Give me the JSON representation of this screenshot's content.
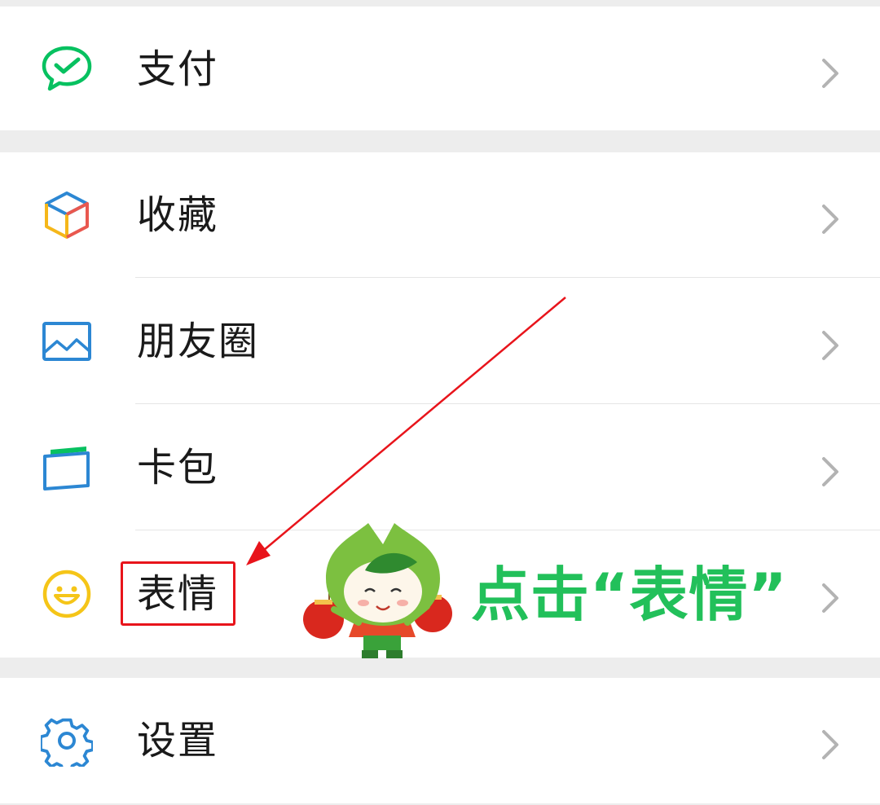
{
  "menu": {
    "items": [
      {
        "key": "pay",
        "label": "支付",
        "icon": "wechat-pay-icon",
        "color": "#07c160"
      },
      {
        "key": "favorites",
        "label": "收藏",
        "icon": "favorites-cube-icon",
        "color": "#f5b71a"
      },
      {
        "key": "moments",
        "label": "朋友圈",
        "icon": "moments-picture-icon",
        "color": "#2c87d3"
      },
      {
        "key": "cards",
        "label": "卡包",
        "icon": "card-wallet-icon",
        "color": "#2c87d3"
      },
      {
        "key": "stickers",
        "label": "表情",
        "icon": "smiley-face-icon",
        "color": "#f5c518"
      },
      {
        "key": "settings",
        "label": "设置",
        "icon": "gear-icon",
        "color": "#2c87d3"
      }
    ]
  },
  "annotation": {
    "text": "点击“表情”",
    "highlight_color": "#e8141b",
    "text_color": "#22c05a",
    "mascot": "leaf-sprout-mascot-with-lanterns"
  }
}
